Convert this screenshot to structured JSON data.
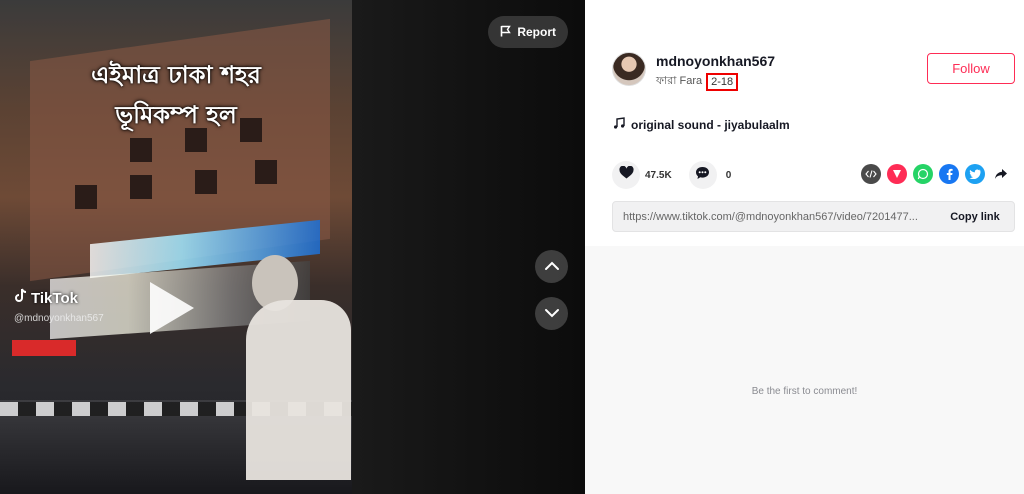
{
  "video": {
    "overlay_line1": "এইমাত্র ঢাকা শহর",
    "overlay_line2": "ভূমিকম্প হল",
    "watermark_brand": "TikTok",
    "watermark_handle": "@mdnoyonkhan567",
    "report_label": "Report",
    "nav_up_icon": "chevron-up-icon",
    "nav_down_icon": "chevron-down-icon"
  },
  "author": {
    "username": "mdnoyonkhan567",
    "display_name": "ফারা Fara",
    "date": "2-18",
    "follow_label": "Follow"
  },
  "sound": {
    "label": "original sound - jiyabulaalm"
  },
  "stats": {
    "likes": "47.5K",
    "comments": "0"
  },
  "share_icons": [
    "embed-icon",
    "send-to-friends-icon",
    "whatsapp-icon",
    "facebook-icon",
    "twitter-icon",
    "share-arrow-icon"
  ],
  "copy_link": {
    "url": "https://www.tiktok.com/@mdnoyonkhan567/video/7201477...",
    "button_label": "Copy link"
  },
  "comments": {
    "empty_text": "Be the first to comment!"
  },
  "colors": {
    "accent": "#fe2c55",
    "date_highlight": "#ee0000",
    "whatsapp": "#25d366",
    "facebook": "#1877f2",
    "twitter": "#1da1f2",
    "embed": "#4a4a4a",
    "send": "#fe2c55"
  }
}
